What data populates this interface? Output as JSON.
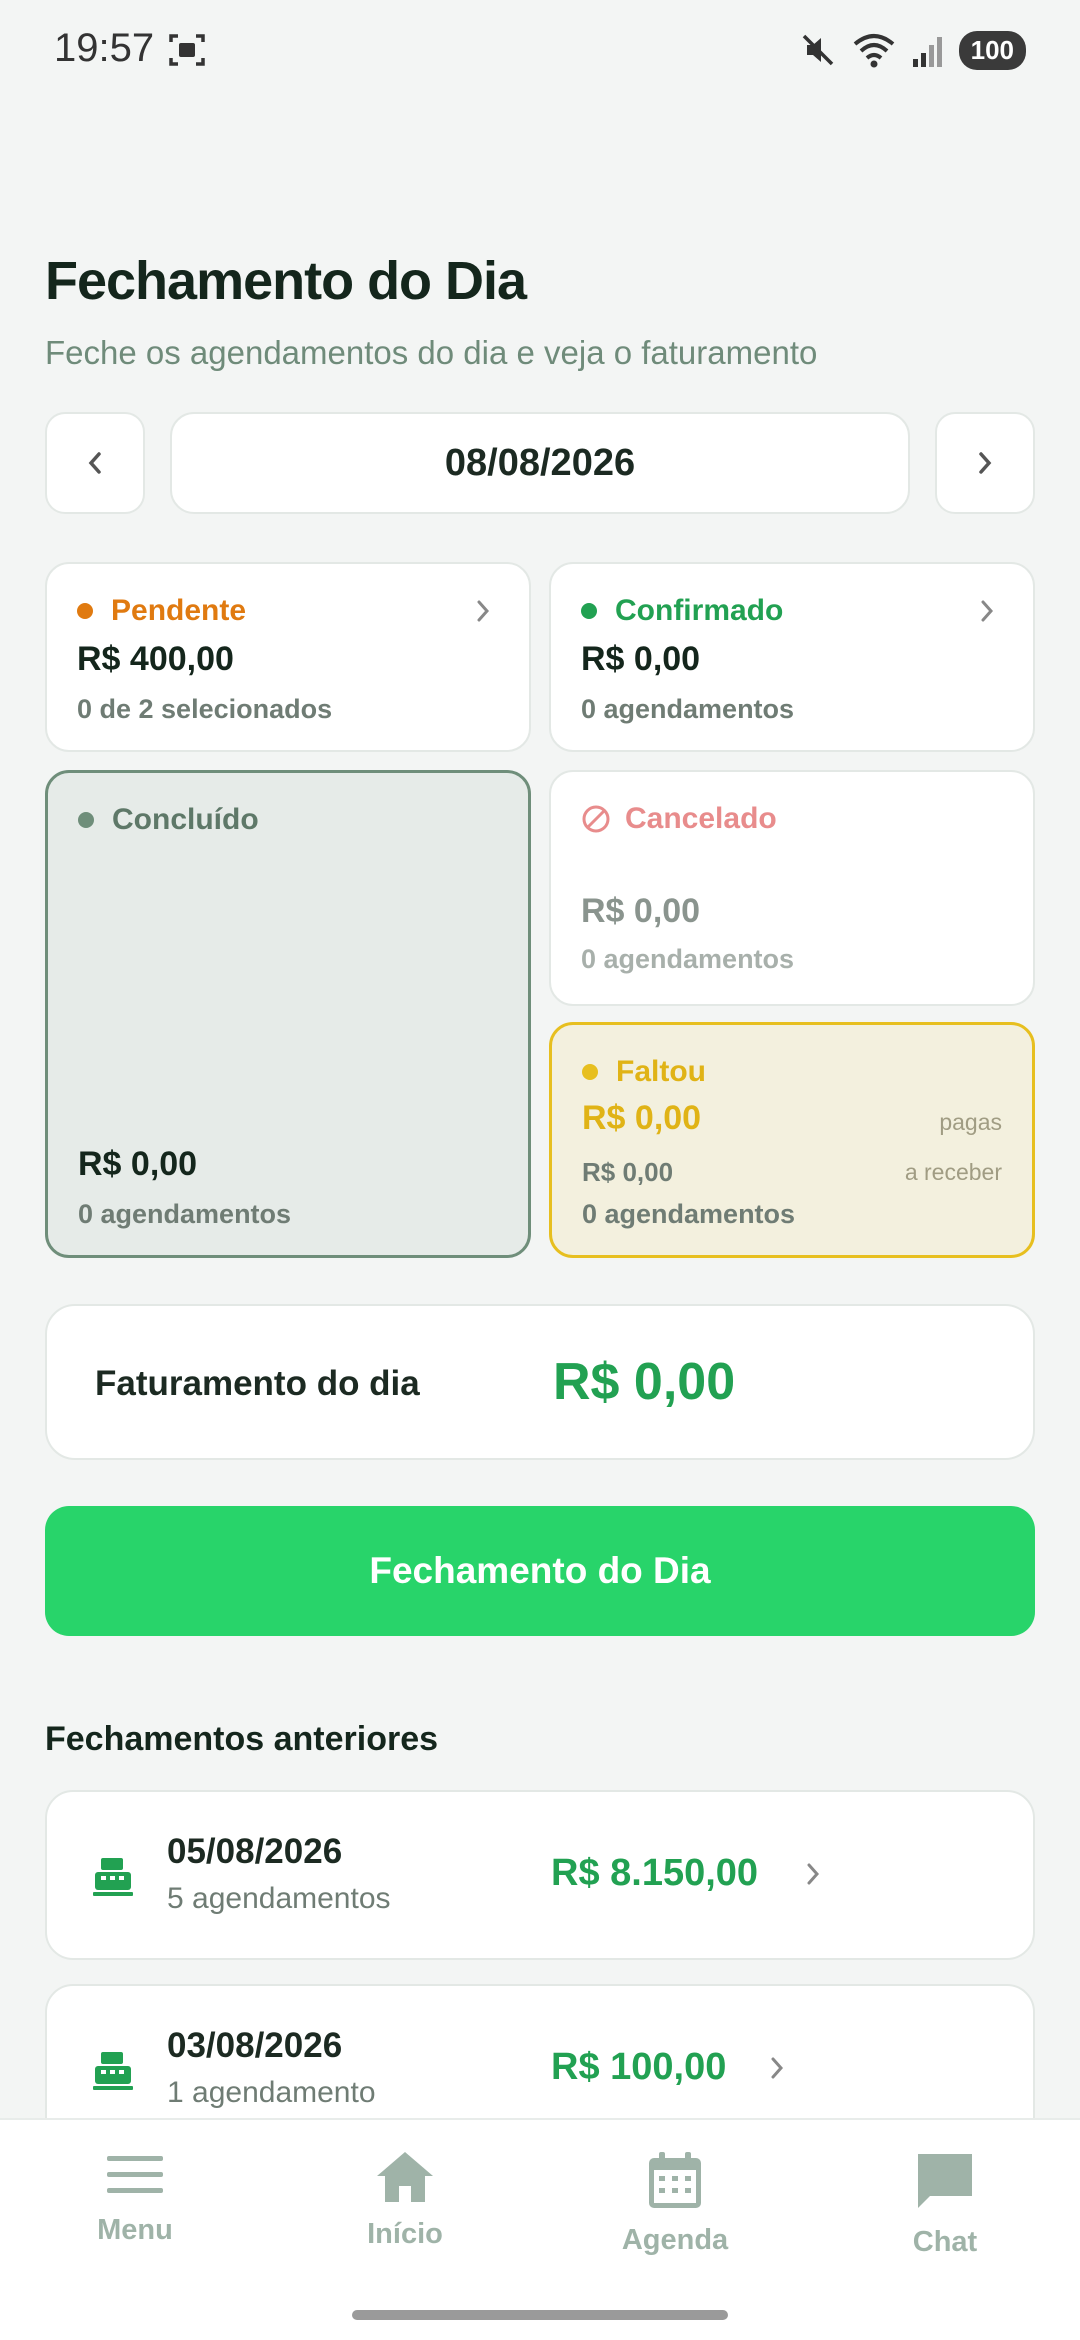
{
  "status_bar": {
    "time": "19:57",
    "battery": "100",
    "icons": [
      "screen-record-icon",
      "mute-icon",
      "wifi-icon",
      "signal-icon",
      "battery-icon"
    ]
  },
  "header": {
    "title": "Fechamento do Dia",
    "subtitle": "Feche os agendamentos do dia e veja o faturamento"
  },
  "date_nav": {
    "date": "08/08/2026",
    "prev_icon": "chevron-left-icon",
    "next_icon": "chevron-right-icon"
  },
  "cards": {
    "pendente": {
      "label": "Pendente",
      "amount": "R$ 400,00",
      "meta": "0 de 2 selecionados",
      "color": "#e07a10"
    },
    "confirmado": {
      "label": "Confirmado",
      "amount": "R$ 0,00",
      "meta": "0 agendamentos",
      "color": "#22a152"
    },
    "concluido": {
      "label": "Concluído",
      "amount": "R$ 0,00",
      "meta": "0 agendamentos",
      "color": "#6f8e7a"
    },
    "cancelado": {
      "label": "Cancelado",
      "amount": "R$ 0,00",
      "meta": "0 agendamentos",
      "color": "#e88c8c"
    },
    "faltou": {
      "label": "Faltou",
      "amount_paid": "R$ 0,00",
      "paid_note": "pagas",
      "amount_receivable": "R$ 0,00",
      "receivable_note": "a receber",
      "meta": "0 agendamentos",
      "color": "#e7bf1f"
    }
  },
  "revenue": {
    "label": "Faturamento do dia",
    "value": "R$ 0,00"
  },
  "close_button": {
    "label": "Fechamento do Dia"
  },
  "history": {
    "title": "Fechamentos anteriores",
    "items": [
      {
        "date": "05/08/2026",
        "count": "5 agendamentos",
        "value": "R$ 8.150,00"
      },
      {
        "date": "03/08/2026",
        "count": "1 agendamento",
        "value": "R$ 100,00"
      }
    ]
  },
  "bottom_nav": {
    "items": [
      {
        "label": "Menu",
        "icon": "menu-icon"
      },
      {
        "label": "Início",
        "icon": "home-icon"
      },
      {
        "label": "Agenda",
        "icon": "calendar-icon"
      },
      {
        "label": "Chat",
        "icon": "chat-icon"
      }
    ]
  },
  "colors": {
    "accent": "#28d46a",
    "accent_text": "#22a152",
    "nav_inactive": "#9fb3a8"
  }
}
